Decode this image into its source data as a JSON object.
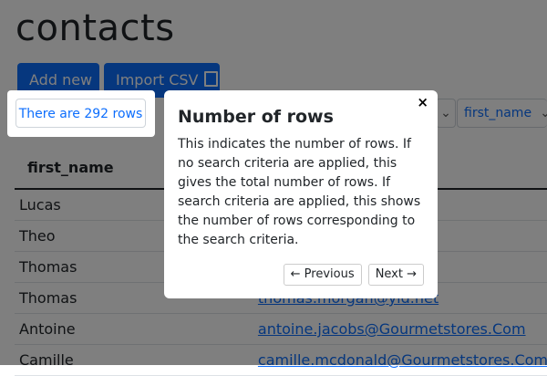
{
  "page": {
    "title": "contacts"
  },
  "toolbar": {
    "add_label": "Add new",
    "import_label": "Import CSV"
  },
  "rowcount": {
    "label": "There are 292 rows"
  },
  "filter": {
    "field_label": "first_name"
  },
  "table": {
    "header": "first_name",
    "rows": [
      {
        "first_name": "Lucas",
        "email": ""
      },
      {
        "first_name": "Theo",
        "email": ""
      },
      {
        "first_name": "Thomas",
        "email": ""
      },
      {
        "first_name": "Thomas",
        "email": "thomas.morgan@yld.net"
      },
      {
        "first_name": "Antoine",
        "email": "antoine.jacobs@Gourmetstores.Com"
      },
      {
        "first_name": "Camille",
        "email": "camille.mcdonald@Gourmetstores.Com"
      }
    ]
  },
  "popover": {
    "title": "Number of rows",
    "body": "This indicates the number of rows. If no search criteria are applied, this gives the total number of rows. If search criteria are applied, this shows the number of rows corresponding to the search criteria.",
    "close_glyph": "×",
    "prev_label": "← Previous",
    "next_label": "Next →"
  },
  "colors": {
    "accent": "#0d6efd",
    "overlay": "rgba(0,0,0,0.5)"
  }
}
